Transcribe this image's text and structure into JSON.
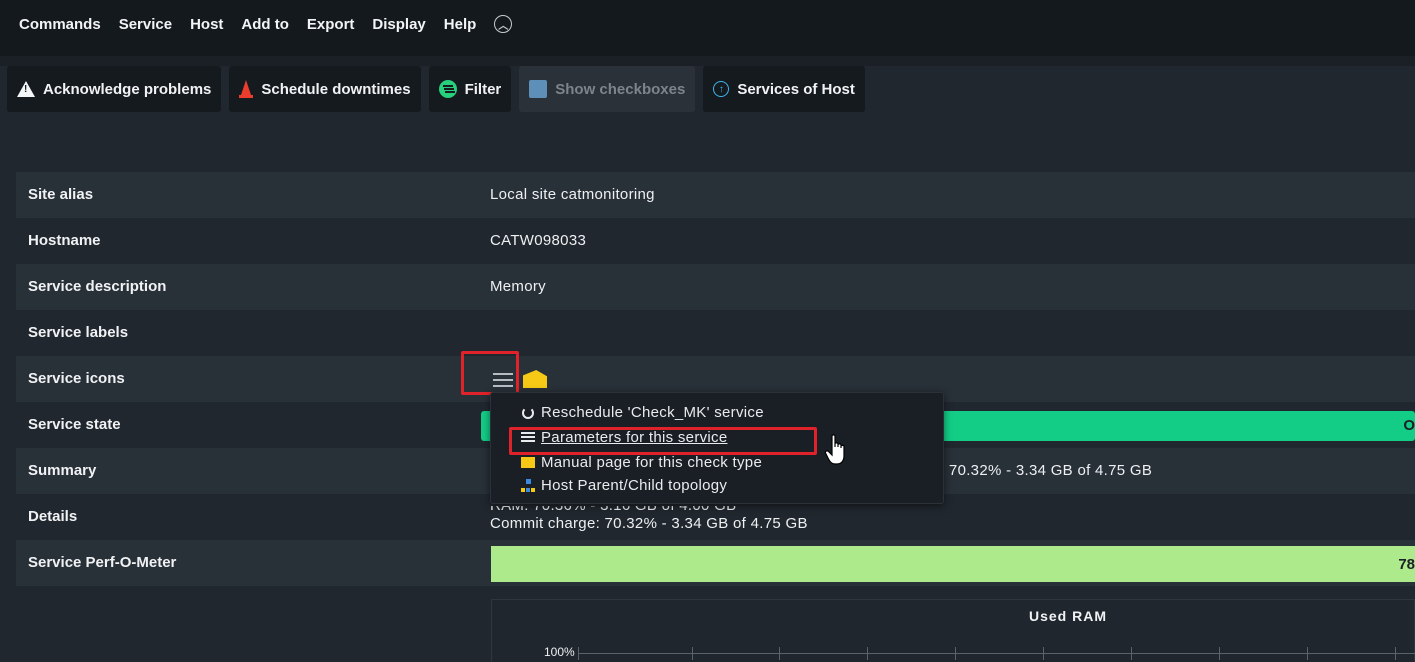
{
  "menu": {
    "items": [
      "Commands",
      "Service",
      "Host",
      "Add to",
      "Export",
      "Display",
      "Help"
    ],
    "collapse_icon": "chevron-up-circle-icon"
  },
  "toolbar": {
    "acknowledge": "Acknowledge problems",
    "schedule": "Schedule downtimes",
    "filter": "Filter",
    "show_checkboxes": "Show checkboxes",
    "services_of_host": "Services of Host"
  },
  "rows": {
    "site_alias": {
      "label": "Site alias",
      "value": "Local site catmonitoring"
    },
    "hostname": {
      "label": "Hostname",
      "value": "CATW098033"
    },
    "service_description": {
      "label": "Service description",
      "value": "Memory"
    },
    "service_labels": {
      "label": "Service labels",
      "value": ""
    },
    "service_icons": {
      "label": "Service icons"
    },
    "service_state": {
      "label": "Service state",
      "value": "O"
    },
    "summary": {
      "label": "Summary",
      "value": ": 70.32% - 3.34 GB of 4.75 GB"
    },
    "details": {
      "label": "Details",
      "line1": "RAM: 70.36% - 3.16 GB of 4.00 GB",
      "line2": "Commit charge: 70.32% - 3.34 GB of 4.75 GB"
    },
    "perf": {
      "label": "Service Perf-O-Meter",
      "value": "78"
    }
  },
  "popup": {
    "items": [
      "Reschedule 'Check_MK' service",
      "Parameters for this service",
      "Manual page for this check type",
      "Host Parent/Child topology"
    ]
  },
  "graph": {
    "title": "Used RAM",
    "y_tick": "100%"
  },
  "colors": {
    "state_ok": "#13cc86",
    "perf_bar": "#acea8c",
    "highlight": "#e0232b"
  }
}
